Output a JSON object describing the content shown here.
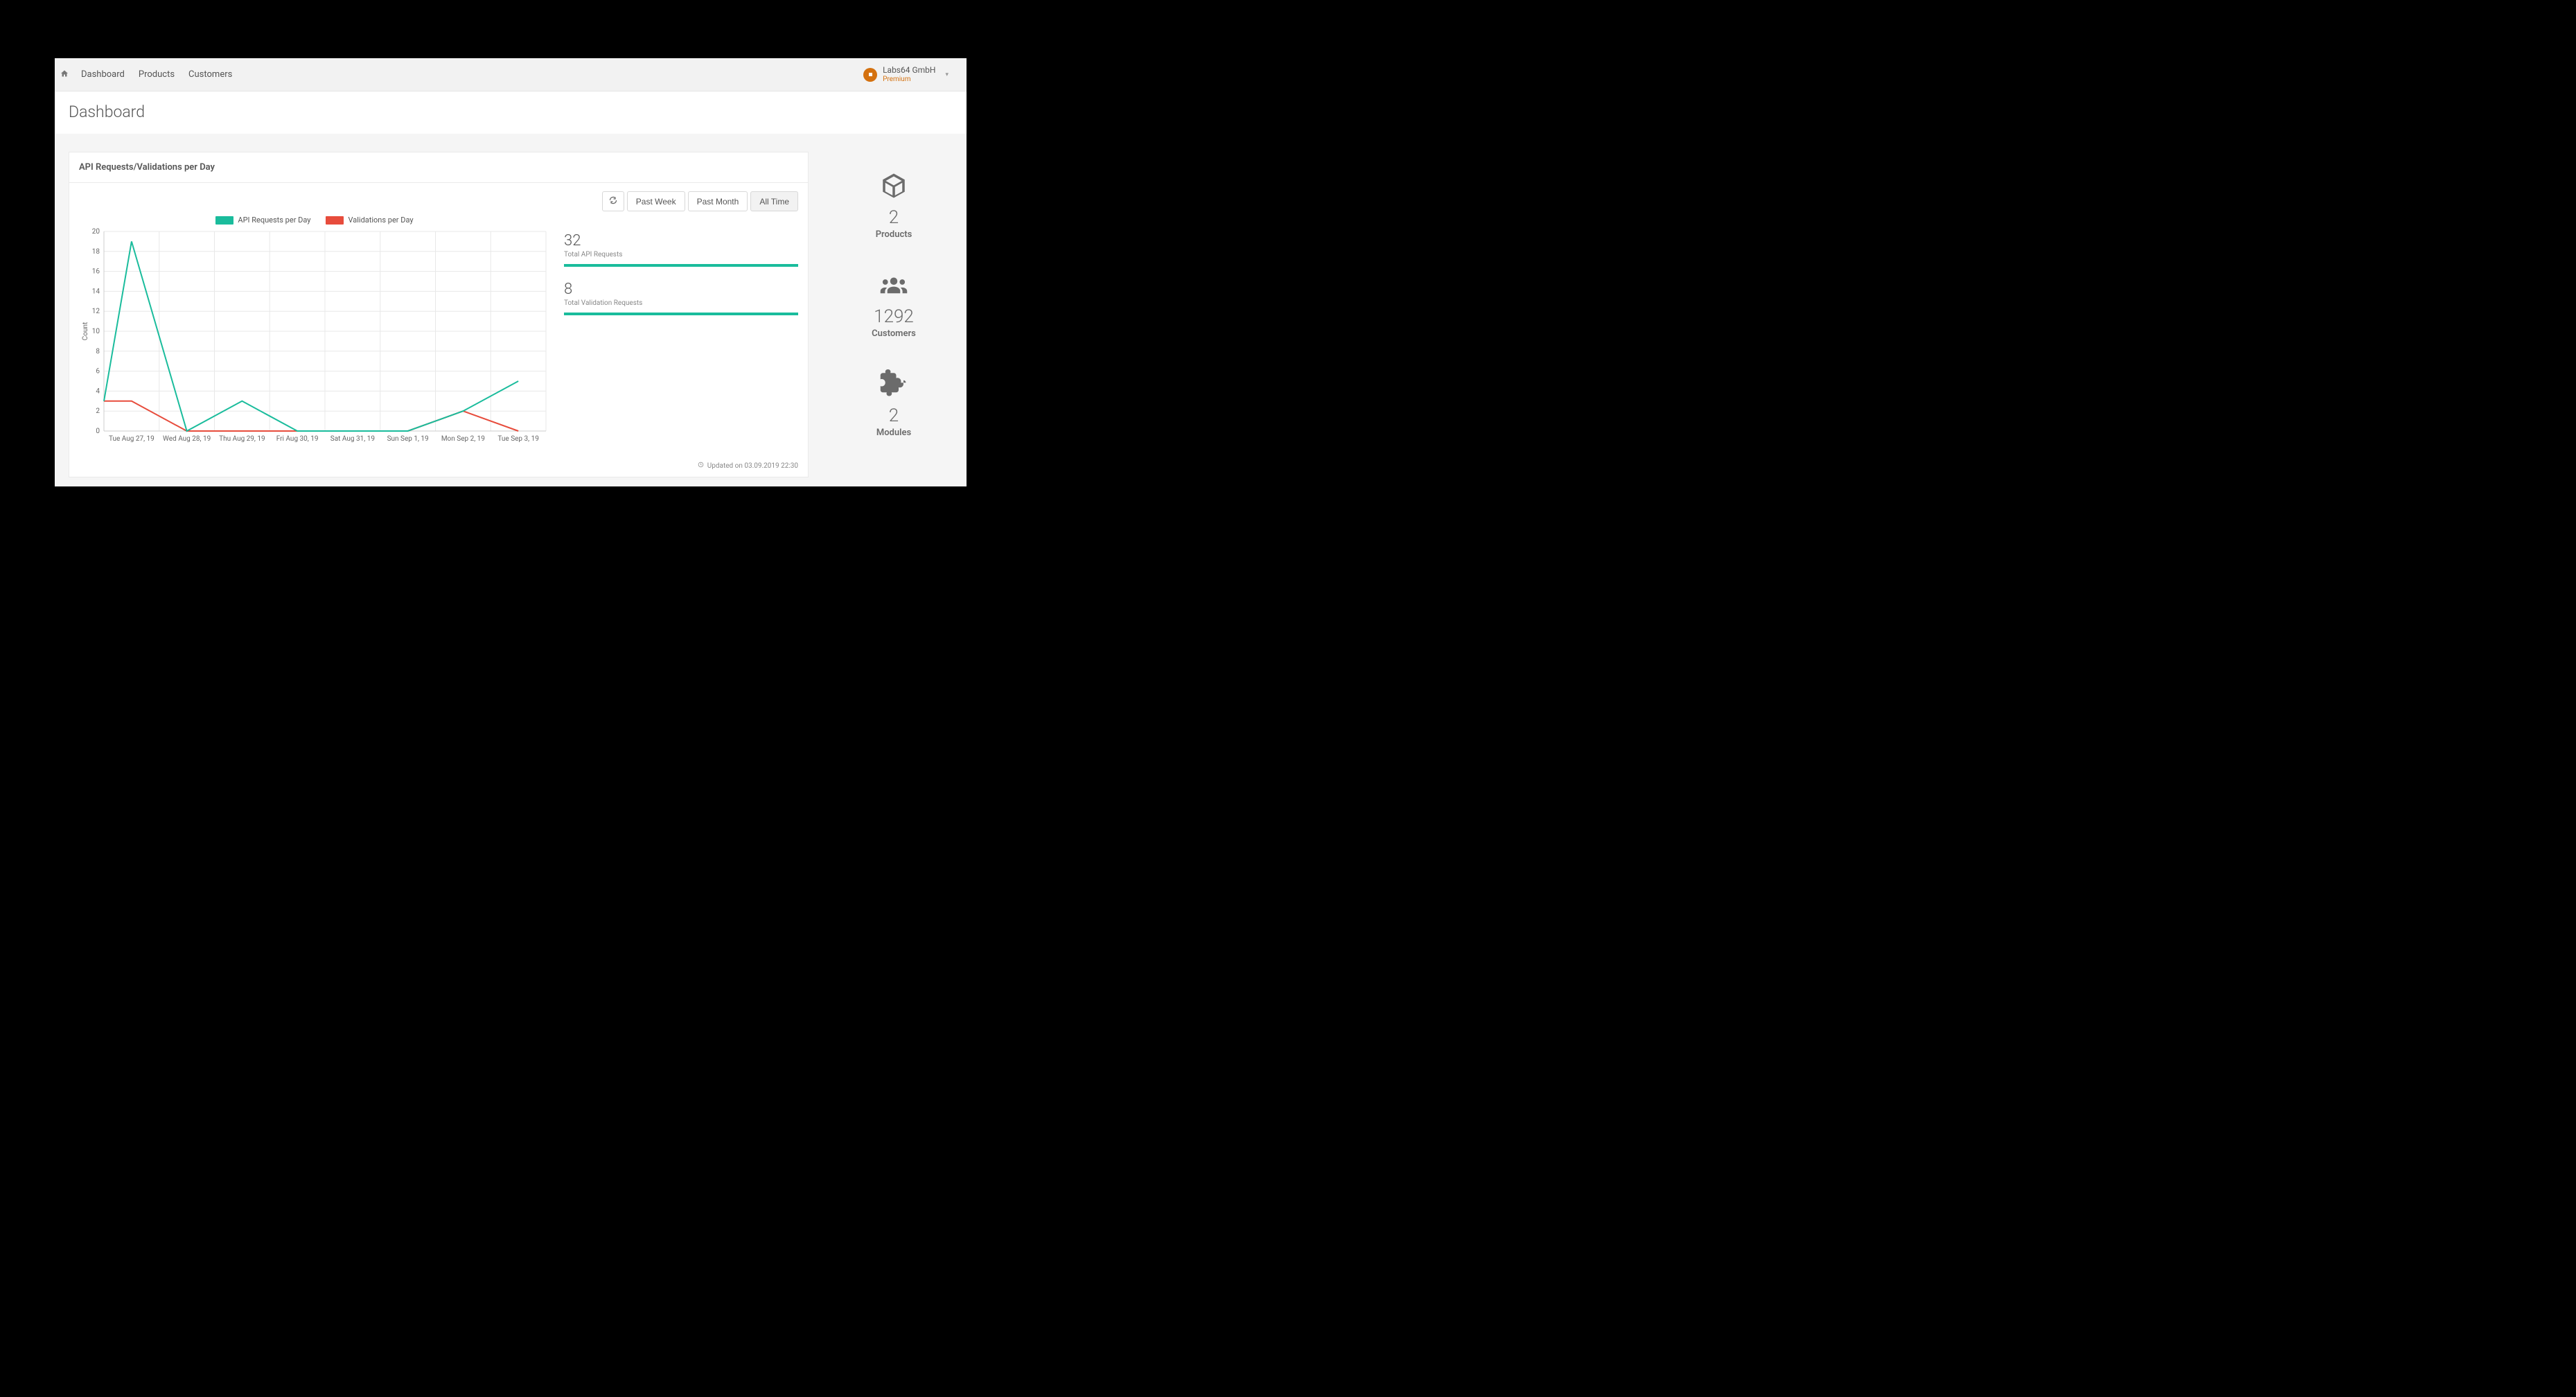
{
  "nav": {
    "links": [
      "Dashboard",
      "Products",
      "Customers"
    ],
    "account_name": "Labs64 GmbH",
    "account_tier": "Premium"
  },
  "page_title": "Dashboard",
  "panel_title": "API Requests/Validations per Day",
  "toolbar": {
    "past_week": "Past Week",
    "past_month": "Past Month",
    "all_time": "All Time"
  },
  "chart_data": {
    "type": "line",
    "xlabel": "",
    "ylabel": "Count",
    "ylim": [
      0,
      20
    ],
    "yticks": [
      0,
      2,
      4,
      6,
      8,
      10,
      12,
      14,
      16,
      18,
      20
    ],
    "categories": [
      "Tue Aug 27, 19",
      "Wed Aug 28, 19",
      "Thu Aug 29, 19",
      "Fri Aug 30, 19",
      "Sat Aug 31, 19",
      "Sun Sep 1, 19",
      "Mon Sep 2, 19",
      "Tue Sep 3, 19"
    ],
    "series": [
      {
        "name": "API Requests per Day",
        "color": "#1abc9c",
        "values": [
          19,
          0,
          3,
          0,
          0,
          0,
          2,
          5
        ]
      },
      {
        "name": "Validations per Day",
        "color": "#e74c3c",
        "values": [
          3,
          0,
          0,
          0,
          0,
          0,
          2,
          0
        ]
      }
    ],
    "initial_values": {
      "api": 3,
      "val": 3
    }
  },
  "stats": {
    "total_api": {
      "value": "32",
      "label": "Total API Requests"
    },
    "total_val": {
      "value": "8",
      "label": "Total Validation Requests"
    }
  },
  "updated": "Updated on 03.09.2019 22:30",
  "side_stats": {
    "products": {
      "value": "2",
      "label": "Products"
    },
    "customers": {
      "value": "1292",
      "label": "Customers"
    },
    "modules": {
      "value": "2",
      "label": "Modules"
    }
  },
  "colors": {
    "accent": "#1abc9c",
    "brand": "#d4710f"
  }
}
